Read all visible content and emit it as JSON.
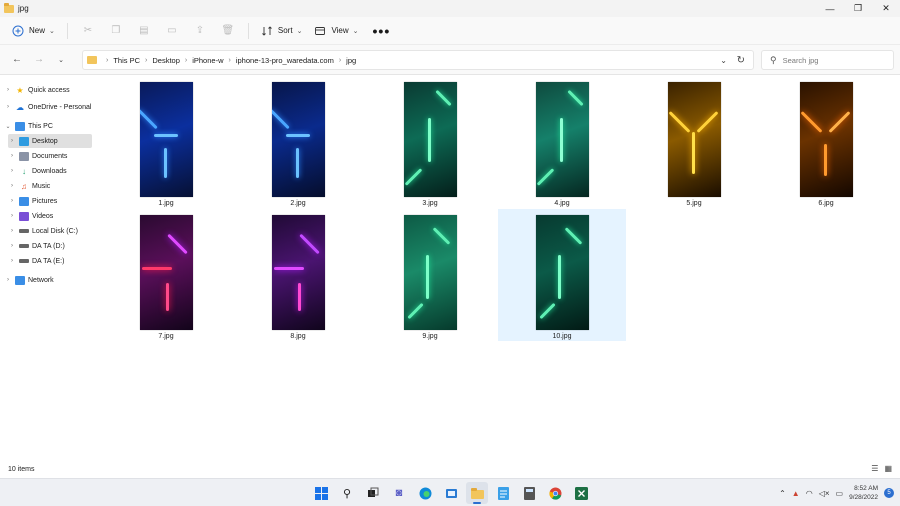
{
  "window": {
    "title": "jpg"
  },
  "window_controls": {
    "minimize": "—",
    "maximize": "❐",
    "close": "✕"
  },
  "toolbar": {
    "new_label": "New",
    "sort_label": "Sort",
    "view_label": "View",
    "more": "•••"
  },
  "address": {
    "crumbs": [
      "This PC",
      "Desktop",
      "iPhone-w",
      "iphone-13-pro_waredata.com",
      "jpg"
    ]
  },
  "search": {
    "placeholder": "Search jpg"
  },
  "sidebar": {
    "items": [
      {
        "label": "Quick access",
        "icon": "star-icon"
      },
      {
        "label": "OneDrive - Personal",
        "icon": "cloud-icon"
      },
      {
        "label": "This PC",
        "icon": "monitor-icon"
      },
      {
        "label": "Desktop",
        "icon": "desktop-icon"
      },
      {
        "label": "Documents",
        "icon": "documents-icon"
      },
      {
        "label": "Downloads",
        "icon": "download-icon"
      },
      {
        "label": "Music",
        "icon": "music-icon"
      },
      {
        "label": "Pictures",
        "icon": "pictures-icon"
      },
      {
        "label": "Videos",
        "icon": "videos-icon"
      },
      {
        "label": "Local Disk (C:)",
        "icon": "drive-icon"
      },
      {
        "label": "DA TA (D:)",
        "icon": "drive-icon"
      },
      {
        "label": "DA TA (E:)",
        "icon": "drive-icon"
      },
      {
        "label": "Network",
        "icon": "network-icon"
      }
    ]
  },
  "files": [
    {
      "name": "1.jpg",
      "theme": "blue"
    },
    {
      "name": "2.jpg",
      "theme": "blue"
    },
    {
      "name": "3.jpg",
      "theme": "green"
    },
    {
      "name": "4.jpg",
      "theme": "green"
    },
    {
      "name": "5.jpg",
      "theme": "gold"
    },
    {
      "name": "6.jpg",
      "theme": "orange"
    },
    {
      "name": "7.jpg",
      "theme": "red"
    },
    {
      "name": "8.jpg",
      "theme": "purple"
    },
    {
      "name": "9.jpg",
      "theme": "green"
    },
    {
      "name": "10.jpg",
      "theme": "green",
      "selected": true
    }
  ],
  "status": {
    "item_count": "10 items"
  },
  "taskbar": {
    "time": "8:52 AM",
    "date": "9/28/2022",
    "notification_count": "5"
  },
  "colors": {
    "accent": "#2c6fd0",
    "selection": "#e5f3ff",
    "folder": "#f2c55c"
  }
}
